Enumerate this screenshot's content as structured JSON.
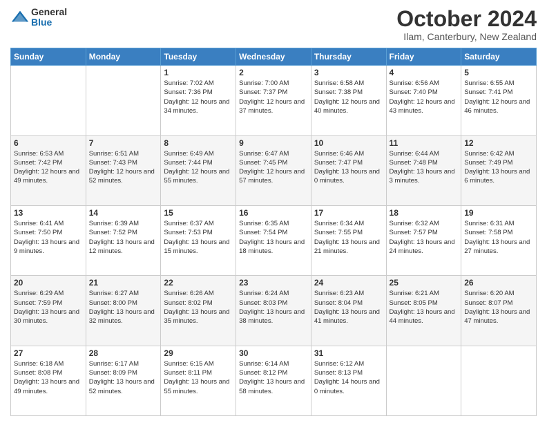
{
  "logo": {
    "general": "General",
    "blue": "Blue"
  },
  "header": {
    "month": "October 2024",
    "location": "Ilam, Canterbury, New Zealand"
  },
  "days_of_week": [
    "Sunday",
    "Monday",
    "Tuesday",
    "Wednesday",
    "Thursday",
    "Friday",
    "Saturday"
  ],
  "weeks": [
    [
      {
        "day": "",
        "info": ""
      },
      {
        "day": "",
        "info": ""
      },
      {
        "day": "1",
        "info": "Sunrise: 7:02 AM\nSunset: 7:36 PM\nDaylight: 12 hours and 34 minutes."
      },
      {
        "day": "2",
        "info": "Sunrise: 7:00 AM\nSunset: 7:37 PM\nDaylight: 12 hours and 37 minutes."
      },
      {
        "day": "3",
        "info": "Sunrise: 6:58 AM\nSunset: 7:38 PM\nDaylight: 12 hours and 40 minutes."
      },
      {
        "day": "4",
        "info": "Sunrise: 6:56 AM\nSunset: 7:40 PM\nDaylight: 12 hours and 43 minutes."
      },
      {
        "day": "5",
        "info": "Sunrise: 6:55 AM\nSunset: 7:41 PM\nDaylight: 12 hours and 46 minutes."
      }
    ],
    [
      {
        "day": "6",
        "info": "Sunrise: 6:53 AM\nSunset: 7:42 PM\nDaylight: 12 hours and 49 minutes."
      },
      {
        "day": "7",
        "info": "Sunrise: 6:51 AM\nSunset: 7:43 PM\nDaylight: 12 hours and 52 minutes."
      },
      {
        "day": "8",
        "info": "Sunrise: 6:49 AM\nSunset: 7:44 PM\nDaylight: 12 hours and 55 minutes."
      },
      {
        "day": "9",
        "info": "Sunrise: 6:47 AM\nSunset: 7:45 PM\nDaylight: 12 hours and 57 minutes."
      },
      {
        "day": "10",
        "info": "Sunrise: 6:46 AM\nSunset: 7:47 PM\nDaylight: 13 hours and 0 minutes."
      },
      {
        "day": "11",
        "info": "Sunrise: 6:44 AM\nSunset: 7:48 PM\nDaylight: 13 hours and 3 minutes."
      },
      {
        "day": "12",
        "info": "Sunrise: 6:42 AM\nSunset: 7:49 PM\nDaylight: 13 hours and 6 minutes."
      }
    ],
    [
      {
        "day": "13",
        "info": "Sunrise: 6:41 AM\nSunset: 7:50 PM\nDaylight: 13 hours and 9 minutes."
      },
      {
        "day": "14",
        "info": "Sunrise: 6:39 AM\nSunset: 7:52 PM\nDaylight: 13 hours and 12 minutes."
      },
      {
        "day": "15",
        "info": "Sunrise: 6:37 AM\nSunset: 7:53 PM\nDaylight: 13 hours and 15 minutes."
      },
      {
        "day": "16",
        "info": "Sunrise: 6:35 AM\nSunset: 7:54 PM\nDaylight: 13 hours and 18 minutes."
      },
      {
        "day": "17",
        "info": "Sunrise: 6:34 AM\nSunset: 7:55 PM\nDaylight: 13 hours and 21 minutes."
      },
      {
        "day": "18",
        "info": "Sunrise: 6:32 AM\nSunset: 7:57 PM\nDaylight: 13 hours and 24 minutes."
      },
      {
        "day": "19",
        "info": "Sunrise: 6:31 AM\nSunset: 7:58 PM\nDaylight: 13 hours and 27 minutes."
      }
    ],
    [
      {
        "day": "20",
        "info": "Sunrise: 6:29 AM\nSunset: 7:59 PM\nDaylight: 13 hours and 30 minutes."
      },
      {
        "day": "21",
        "info": "Sunrise: 6:27 AM\nSunset: 8:00 PM\nDaylight: 13 hours and 32 minutes."
      },
      {
        "day": "22",
        "info": "Sunrise: 6:26 AM\nSunset: 8:02 PM\nDaylight: 13 hours and 35 minutes."
      },
      {
        "day": "23",
        "info": "Sunrise: 6:24 AM\nSunset: 8:03 PM\nDaylight: 13 hours and 38 minutes."
      },
      {
        "day": "24",
        "info": "Sunrise: 6:23 AM\nSunset: 8:04 PM\nDaylight: 13 hours and 41 minutes."
      },
      {
        "day": "25",
        "info": "Sunrise: 6:21 AM\nSunset: 8:05 PM\nDaylight: 13 hours and 44 minutes."
      },
      {
        "day": "26",
        "info": "Sunrise: 6:20 AM\nSunset: 8:07 PM\nDaylight: 13 hours and 47 minutes."
      }
    ],
    [
      {
        "day": "27",
        "info": "Sunrise: 6:18 AM\nSunset: 8:08 PM\nDaylight: 13 hours and 49 minutes."
      },
      {
        "day": "28",
        "info": "Sunrise: 6:17 AM\nSunset: 8:09 PM\nDaylight: 13 hours and 52 minutes."
      },
      {
        "day": "29",
        "info": "Sunrise: 6:15 AM\nSunset: 8:11 PM\nDaylight: 13 hours and 55 minutes."
      },
      {
        "day": "30",
        "info": "Sunrise: 6:14 AM\nSunset: 8:12 PM\nDaylight: 13 hours and 58 minutes."
      },
      {
        "day": "31",
        "info": "Sunrise: 6:12 AM\nSunset: 8:13 PM\nDaylight: 14 hours and 0 minutes."
      },
      {
        "day": "",
        "info": ""
      },
      {
        "day": "",
        "info": ""
      }
    ]
  ]
}
